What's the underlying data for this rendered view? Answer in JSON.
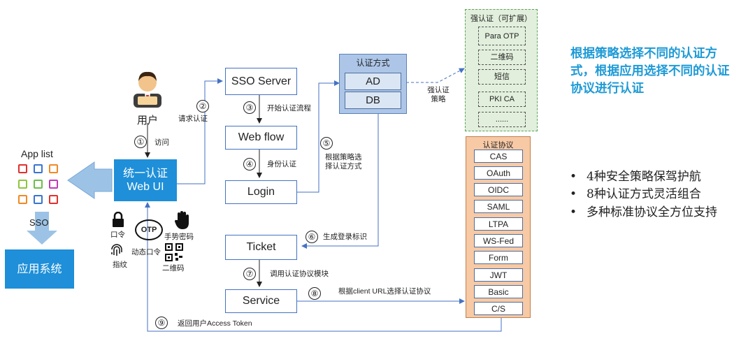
{
  "user": {
    "label": "用户"
  },
  "app_list": {
    "label": "App list"
  },
  "sso_label": "SSO",
  "app_system": {
    "label": "应用系统"
  },
  "web_ui": {
    "line1": "统一认证",
    "line2": "Web UI"
  },
  "flow_boxes": {
    "sso_server": "SSO Server",
    "web_flow": "Web flow",
    "login": "Login",
    "ticket": "Ticket",
    "service": "Service"
  },
  "steps": [
    {
      "num": "①",
      "text": "访问"
    },
    {
      "num": "②",
      "text": "请求认证"
    },
    {
      "num": "③",
      "text": "开始认证流程"
    },
    {
      "num": "④",
      "text": "身份认证"
    },
    {
      "num": "⑤",
      "text": "根据策略选择认证方式"
    },
    {
      "num": "⑥",
      "text": "生成登录标识"
    },
    {
      "num": "⑦",
      "text": "调用认证协议模块"
    },
    {
      "num": "⑧",
      "text": "根据client URL选择认证协议"
    },
    {
      "num": "⑨",
      "text": "返回用户Access Token"
    }
  ],
  "auth_methods": {
    "title": "认证方式",
    "items": [
      "AD",
      "DB"
    ]
  },
  "strong_auth": {
    "title": "强认证（可扩展）",
    "items": [
      "Para OTP",
      "二维码",
      "短信",
      "PKI CA",
      "......"
    ],
    "policy_label": "强认证策略"
  },
  "protocols": {
    "title": "认证协议",
    "items": [
      "CAS",
      "OAuth",
      "OIDC",
      "SAML",
      "LTPA",
      "WS-Fed",
      "Form",
      "JWT",
      "Basic",
      "C/S"
    ]
  },
  "login_methods": {
    "password": "口令",
    "gesture": "手势密码",
    "otp_badge": "OTP",
    "otp": "动态口令",
    "fingerprint": "指纹",
    "qrcode": "二维码"
  },
  "headline": "根据策略选择不同的认证方式，根据应用选择不同的认证协议进行认证",
  "bullets": [
    "4种安全策略保驾护航",
    "8种认证方式灵活组合",
    "多种标准协议全方位支持"
  ],
  "colors": {
    "accent": "#1e8fd8",
    "auth_group": "#adc6e8",
    "strong_group": "#e2efdc",
    "protocol_group": "#f7c9a5",
    "headline": "#1e9ad6"
  }
}
